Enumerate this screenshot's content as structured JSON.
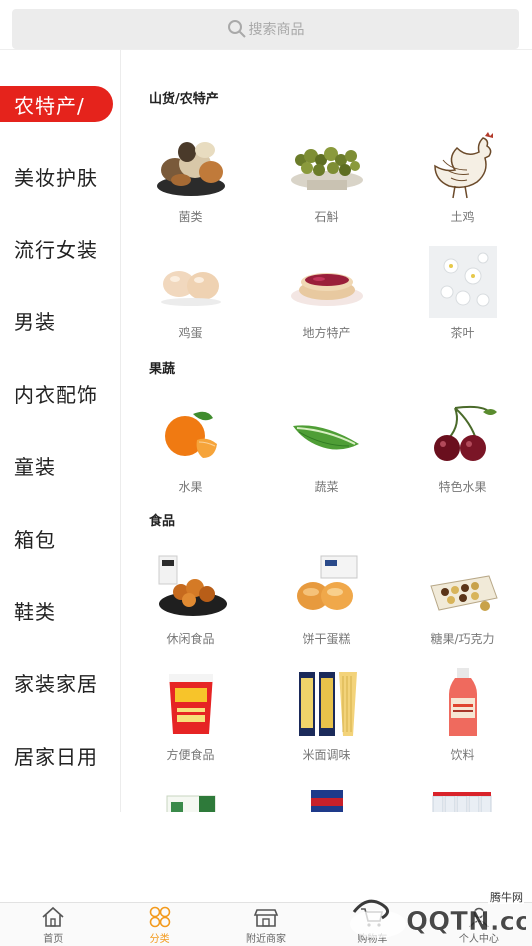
{
  "search": {
    "placeholder": "搜索商品"
  },
  "sidebar": {
    "items": [
      {
        "label": "农特产/",
        "active": true
      },
      {
        "label": "美妆护肤"
      },
      {
        "label": "流行女装"
      },
      {
        "label": "男装"
      },
      {
        "label": "内衣配饰"
      },
      {
        "label": "童装"
      },
      {
        "label": "箱包"
      },
      {
        "label": "鞋类"
      },
      {
        "label": "家装家居"
      },
      {
        "label": "居家日用"
      }
    ]
  },
  "sections": [
    {
      "title": "山货/农特产",
      "items": [
        {
          "label": "菌类",
          "icon": "mushroom-icon"
        },
        {
          "label": "石斛",
          "icon": "dendrobium-icon"
        },
        {
          "label": "土鸡",
          "icon": "chicken-icon"
        },
        {
          "label": "鸡蛋",
          "icon": "egg-icon"
        },
        {
          "label": "地方特产",
          "icon": "pastry-icon"
        },
        {
          "label": "茶叶",
          "icon": "tea-flower-icon"
        }
      ]
    },
    {
      "title": "果蔬",
      "items": [
        {
          "label": "水果",
          "icon": "orange-icon"
        },
        {
          "label": "蔬菜",
          "icon": "lettuce-icon"
        },
        {
          "label": "特色水果",
          "icon": "cherry-icon"
        }
      ]
    },
    {
      "title": "食品",
      "items": [
        {
          "label": "休闲食品",
          "icon": "snack-icon"
        },
        {
          "label": "饼干蛋糕",
          "icon": "cake-icon"
        },
        {
          "label": "糖果/巧克力",
          "icon": "chocolate-icon"
        },
        {
          "label": "方便食品",
          "icon": "cup-noodle-icon"
        },
        {
          "label": "米面调味",
          "icon": "pasta-icon"
        },
        {
          "label": "饮料",
          "icon": "drink-bottle-icon"
        }
      ]
    }
  ],
  "tabbar": {
    "items": [
      {
        "label": "首页",
        "icon": "home-icon"
      },
      {
        "label": "分类",
        "icon": "category-icon",
        "active": true
      },
      {
        "label": "附近商家",
        "icon": "shop-icon"
      },
      {
        "label": "购物车",
        "icon": "cart-icon"
      },
      {
        "label": "个人中心",
        "icon": "user-icon"
      }
    ]
  },
  "watermark": {
    "text": "QQTN.com",
    "tag": "腾牛网"
  },
  "colors": {
    "accent": "#e5231c",
    "tab_active": "#f39a1c"
  }
}
